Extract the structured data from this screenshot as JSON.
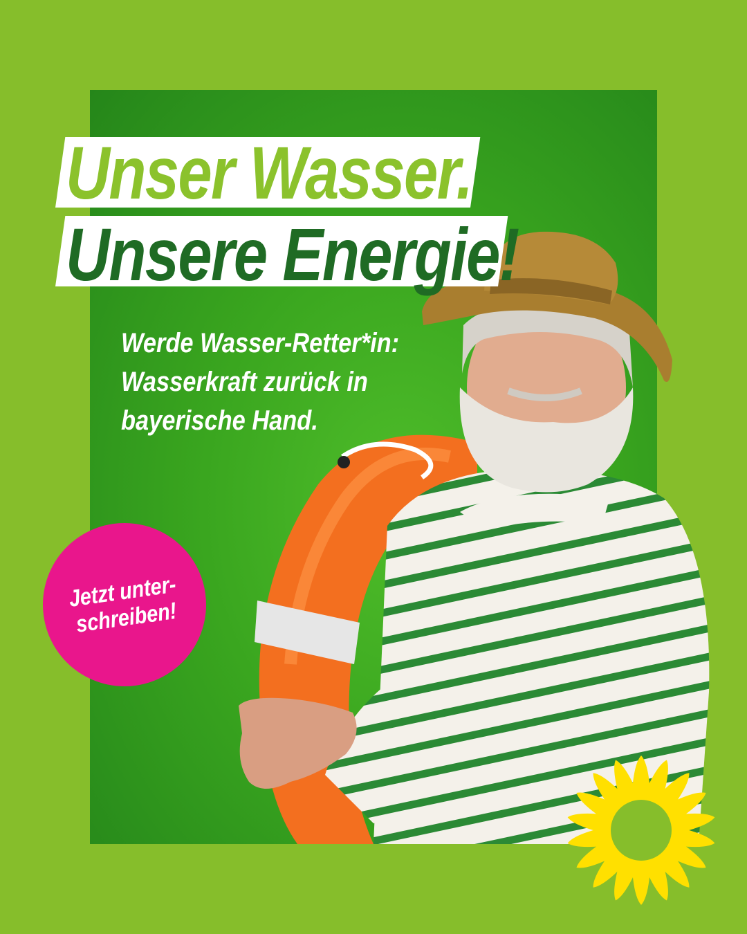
{
  "headline": {
    "line1": "Unser Wasser.",
    "line2": "Unsere Energie!"
  },
  "subheadline": {
    "line1": "Werde Wasser-Retter*in:",
    "line2": "Wasserkraft zurück in",
    "line3": "bayerische Hand."
  },
  "badge": {
    "line1": "Jetzt unter-",
    "line2": "schreiben!"
  },
  "logo": {
    "icon": "sunflower-icon"
  },
  "colors": {
    "frame": "#86be2b",
    "photo_background": "#3aa61f",
    "headline_light": "#8bc22c",
    "headline_dark": "#1f6b24",
    "badge": "#e9168c",
    "sunflower": "#ffe000",
    "lifebuoy": "#f36f1f"
  }
}
